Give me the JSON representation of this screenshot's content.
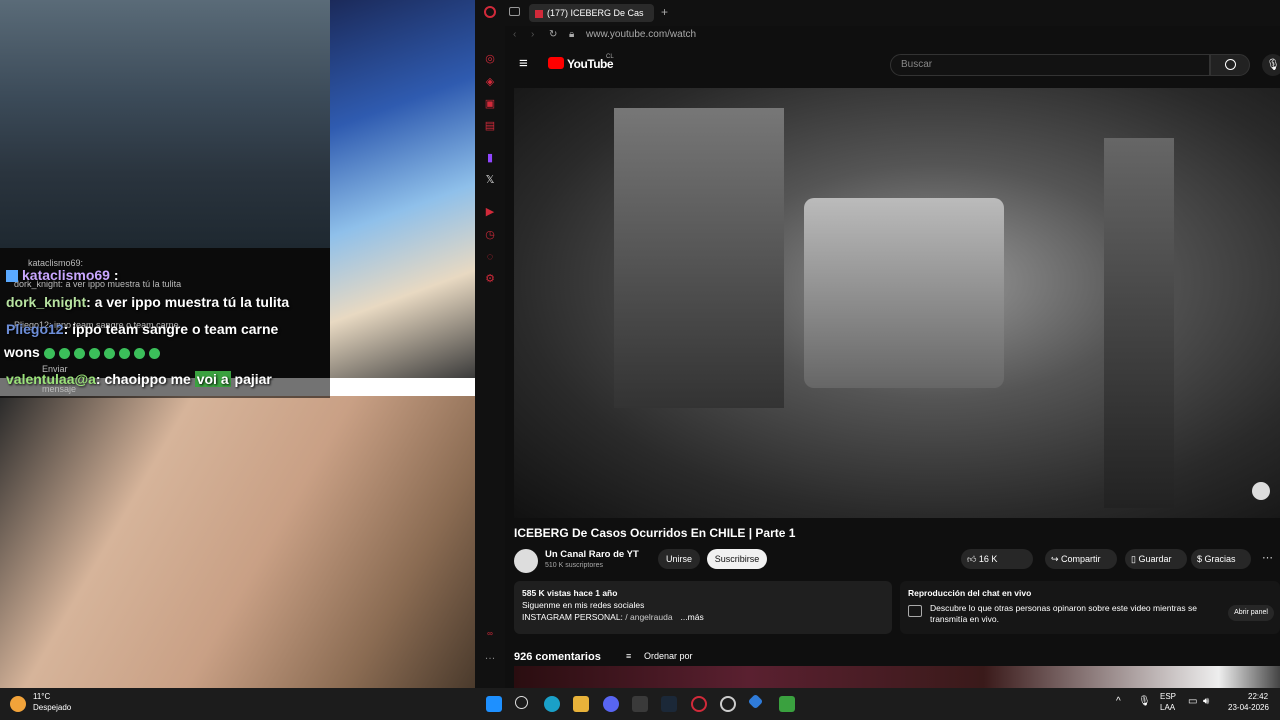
{
  "stream": {
    "chat": [
      {
        "user": "kataclismo69",
        "text": ""
      },
      {
        "user": "dork_knight",
        "text": ": a ver ippo muestra tú la tulita"
      },
      {
        "user": "Pliego12",
        "text": ": ippo team sangre o team carne"
      },
      {
        "user": "wons",
        "text": ""
      },
      {
        "user": "valentulaa@a",
        "text": ": chaoippo me ",
        "highlight": "voi a",
        "rest": " pajiar"
      }
    ],
    "chat_small": {
      "line1": "kataclismo69:",
      "line2": "dork_knight: a ver ippo muestra tú la tulita",
      "line3": "Pliego12: ippo team sangre o team carne",
      "send_label_1": "Enviar",
      "send_label_2": "mensaje"
    }
  },
  "browser": {
    "tab_title": "(177) ICEBERG De Cas",
    "url": "www.youtube.com/watch",
    "yt_logo": "YouTube",
    "yt_region": "CL",
    "search_placeholder": "Buscar"
  },
  "video": {
    "title": "ICEBERG De Casos Ocurridos En CHILE | Parte 1",
    "channel": "Un Canal Raro de YT",
    "subscribers": "510 K suscriptores",
    "join_label": "Unirse",
    "subscribe_label": "Suscribirse",
    "likes": "16 K",
    "share_label": "Compartir",
    "save_label": "Guardar",
    "thanks_label": "Gracias",
    "views_date": "585 K vistas  hace 1 año",
    "desc_line1": "Siguenme en mis redes sociales",
    "desc_line2": "INSTAGRAM PERSONAL: ",
    "desc_handle": "/ angelrauda",
    "desc_more": "...más",
    "chat_replay_title": "Reproducción del chat en vivo",
    "chat_replay_text": "Descubre lo que otras personas opinaron sobre este video mientras se transmitía en vivo.",
    "open_panel_label": "Abrir panel",
    "comments_count": "926 comentarios",
    "sort_label": "Ordenar por"
  },
  "taskbar": {
    "temp": "11°C",
    "weather": "Despejado",
    "lang1": "ESP",
    "lang2": "LAA",
    "time": "22:42",
    "date": "23-04-2026"
  },
  "colors": {
    "yt_red": "#ff0000",
    "opera_red": "#d12a3a",
    "highlight_green": "#3aa13f"
  }
}
